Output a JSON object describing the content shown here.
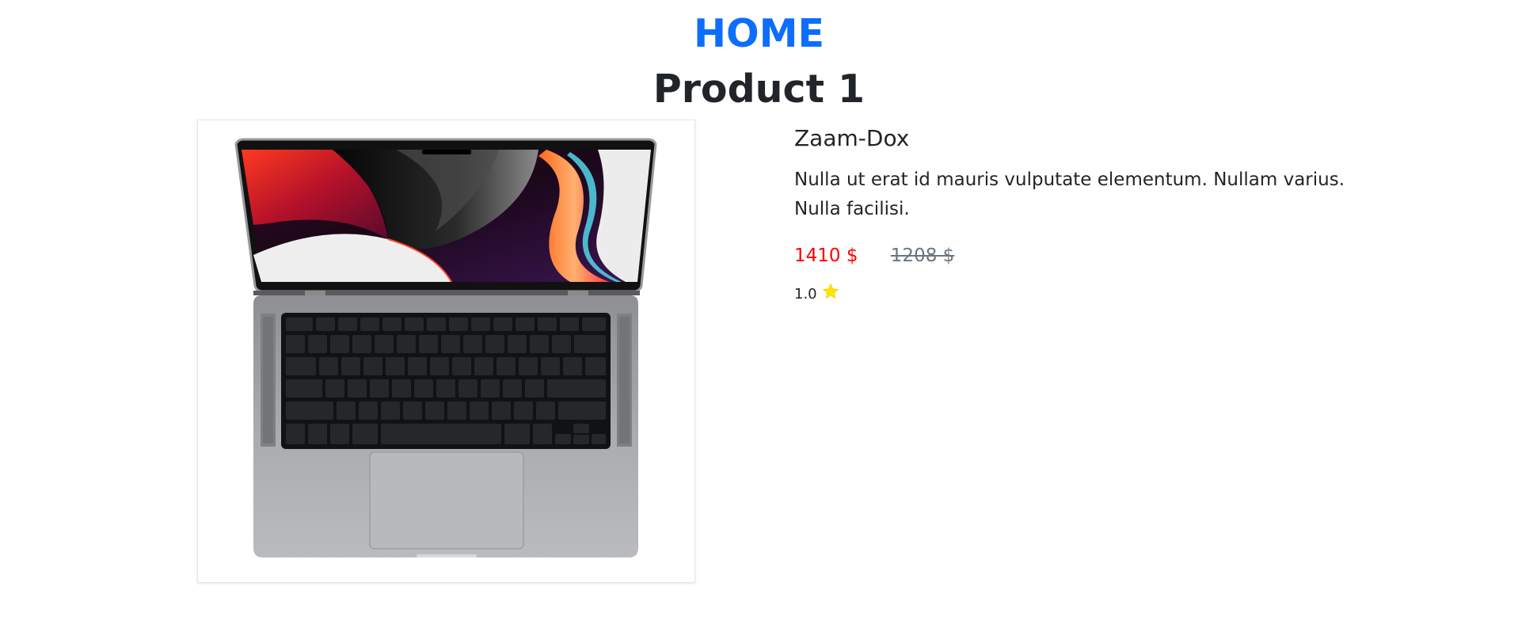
{
  "nav": {
    "home_label": "HOME"
  },
  "product": {
    "title": "Product 1",
    "brand": "Zaam-Dox",
    "description": "Nulla ut erat id mauris vulputate elementum. Nullam varius. Nulla facilisi.",
    "price": "1410 $",
    "old_price": "1208 $",
    "rating": "1.0",
    "image_icon": "laptop-image"
  },
  "colors": {
    "link": "#0d6efd",
    "price": "#ff0000",
    "old_price": "#6c757d",
    "star": "#ffe600"
  }
}
